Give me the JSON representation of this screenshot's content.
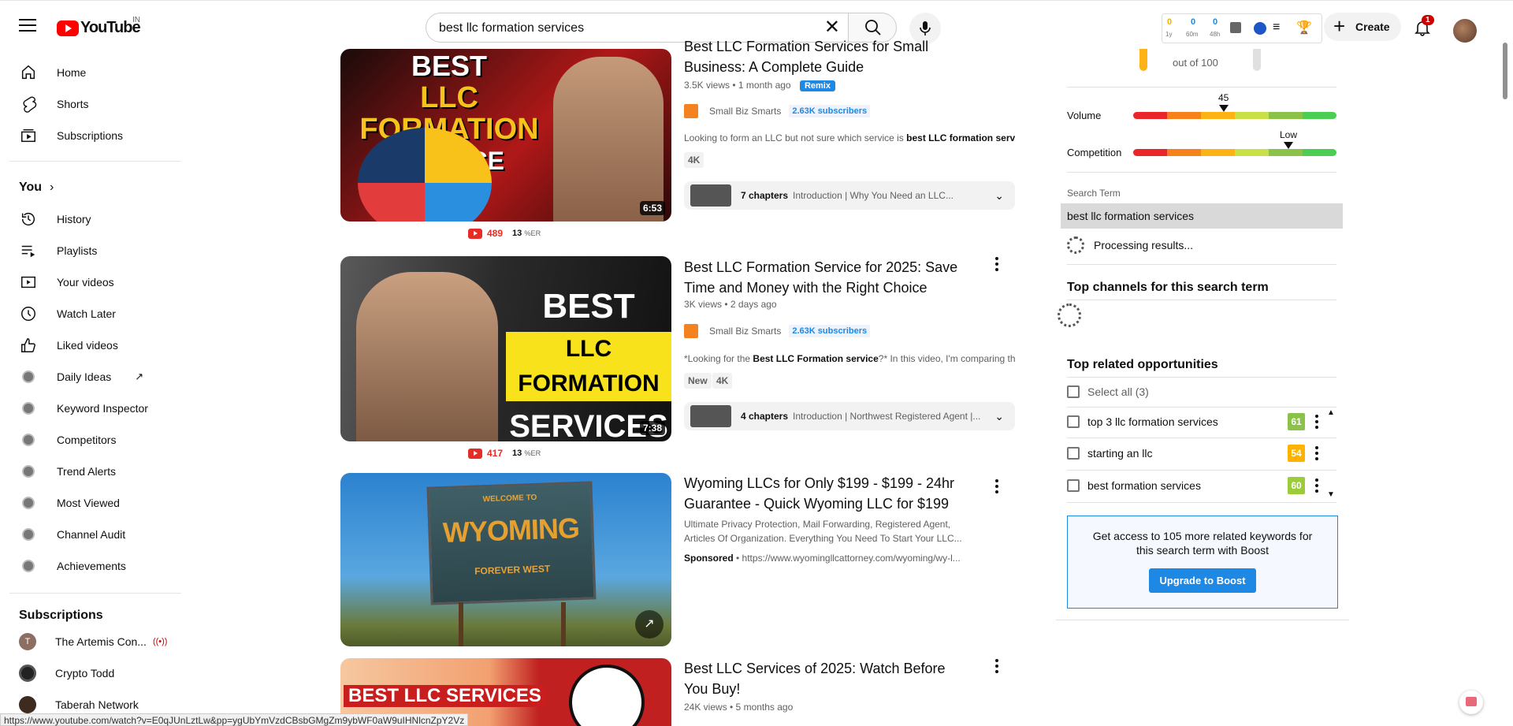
{
  "header": {
    "logo_text": "YouTube",
    "country_code": "IN",
    "search_value": "best llc formation services",
    "create_label": "Create",
    "notification_count": "1",
    "ext_stats": [
      {
        "value": "0",
        "label": "1y"
      },
      {
        "value": "0",
        "label": "60m"
      },
      {
        "value": "0",
        "label": "48h"
      }
    ]
  },
  "sidebar": {
    "main": [
      {
        "label": "Home",
        "icon": "home-icon"
      },
      {
        "label": "Shorts",
        "icon": "shorts-icon"
      },
      {
        "label": "Subscriptions",
        "icon": "subscriptions-icon"
      }
    ],
    "you_label": "You",
    "you_items": [
      {
        "label": "History",
        "icon": "history-icon"
      },
      {
        "label": "Playlists",
        "icon": "playlists-icon"
      },
      {
        "label": "Your videos",
        "icon": "your-videos-icon"
      },
      {
        "label": "Watch Later",
        "icon": "clock-icon"
      },
      {
        "label": "Liked videos",
        "icon": "thumbs-up-icon"
      }
    ],
    "tools": [
      "Daily Ideas",
      "Keyword Inspector",
      "Competitors",
      "Trend Alerts",
      "Most Viewed",
      "Channel Audit",
      "Achievements"
    ],
    "subscriptions_label": "Subscriptions",
    "subscriptions": [
      "The Artemis Con...",
      "Crypto Todd",
      "Taberah Network"
    ]
  },
  "videos": [
    {
      "title": "Best LLC Formation Services for Small Business: A Complete Guide",
      "meta": "3.5K views • 1 month ago",
      "remix": "Remix",
      "channel": "Small Biz Smarts",
      "subs": "2.63K subscribers",
      "desc_pre": "Looking to form an LLC but not sure which service is ",
      "desc_bold": "best LLC formation serv...",
      "tags": [
        "4K"
      ],
      "chapters_count": "7 chapters",
      "chapters_text": "Introduction | Why You Need an LLC...",
      "duration": "6:53",
      "stat_views": "489",
      "stat_er": "13"
    },
    {
      "title": "Best LLC Formation Service for 2025: Save Time and Money with the Right Choice",
      "meta": "3K views • 2 days ago",
      "channel": "Small Biz Smarts",
      "subs": "2.63K subscribers",
      "desc_pre": "*Looking for the ",
      "desc_bold": "Best LLC Formation service",
      "desc_post": "?* In this video, I'm comparing th...",
      "tags": [
        "New",
        "4K"
      ],
      "chapters_count": "4 chapters",
      "chapters_text": "Introduction | Northwest Registered Agent |...",
      "duration": "7:38",
      "stat_views": "417",
      "stat_er": "13"
    },
    {
      "title": "Wyoming LLCs for Only $199 - $199 - 24hr Guarantee - Quick Wyoming LLC for $199",
      "desc_line1": "Ultimate Privacy Protection, Mail Forwarding, Registered Agent,",
      "desc_line2": "Articles Of Organization. Everything You Need To Start Your LLC...",
      "sponsored": "Sponsored",
      "ad_url": "https://www.wyomingllcattorney.com/wyoming/wy-l...",
      "thumb_top": "WELCOME TO",
      "thumb_main": "WYOMING",
      "thumb_bottom": "FOREVER WEST"
    },
    {
      "title": "Best LLC Services of 2025: Watch Before You Buy!",
      "meta": "24K views • 5 months ago",
      "thumb_text": "BEST LLC SERVICES"
    }
  ],
  "thumb_text": {
    "v1_line1": "BEST",
    "v1_line2": "LLC FORMATION",
    "v1_line3": "SERVICE",
    "v2_line1": "BEST",
    "v2_line2": "LLC FORMATION",
    "v2_line3": "SERVICES"
  },
  "stat_er_unit": "%ER",
  "panel": {
    "score_label": "out of 100",
    "volume_label": "Volume",
    "volume_value": "45",
    "competition_label": "Competition",
    "competition_value": "Low",
    "search_term_label": "Search Term",
    "search_term": "best llc formation services",
    "processing": "Processing results...",
    "top_channels": "Top channels for this search term",
    "top_related": "Top related opportunities",
    "select_all": "Select all (3)",
    "keywords": [
      {
        "text": "top 3 llc formation services",
        "score": "61",
        "color": "#8bc34a"
      },
      {
        "text": "starting an llc",
        "score": "54",
        "color": "#ffb300"
      },
      {
        "text": "best formation services",
        "score": "60",
        "color": "#9ccc3a"
      }
    ],
    "boost_text": "Get access to 105 more related keywords for this search term with Boost",
    "boost_button": "Upgrade to Boost"
  },
  "status_url": "https://www.youtube.com/watch?v=E0qJUnLztLw&pp=ygUbYmVzdCBsbGMgZm9ybWF0aW9uIHNlcnZpY2Vz",
  "colors": {
    "accent": "#1e88e5",
    "youtube_red": "#ff0000",
    "bar": [
      "#e8262b",
      "#f7821b",
      "#fbb316",
      "#c9e046",
      "#8bc34a",
      "#4ccd54"
    ]
  }
}
